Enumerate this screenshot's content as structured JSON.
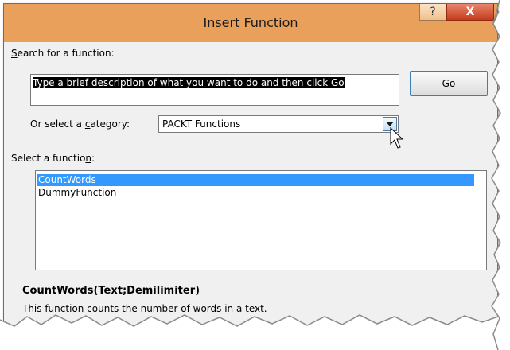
{
  "window": {
    "title": "Insert Function",
    "help_label": "?",
    "close_label": "X"
  },
  "search": {
    "label_prefix": "",
    "label_accel": "S",
    "label_rest": "earch for a function:",
    "value": "Type a brief description of what you want to do and then click Go",
    "go_label_accel": "G",
    "go_label_rest": "o"
  },
  "category": {
    "label_pre": "Or select a ",
    "label_accel": "c",
    "label_post": "ategory:",
    "selected": "PACKT Functions"
  },
  "functions": {
    "label_pre": "Select a functio",
    "label_accel": "n",
    "label_post": ":",
    "items": [
      {
        "label": "CountWords",
        "selected": true
      },
      {
        "label": "DummyFunction",
        "selected": false
      }
    ]
  },
  "details": {
    "signature": "CountWords(Text;Demilimiter)",
    "description": "This function counts the number of words in a text."
  },
  "colors": {
    "titlebar": "#e8a05a",
    "close": "#c43b1c",
    "selection": "#3399ff"
  }
}
